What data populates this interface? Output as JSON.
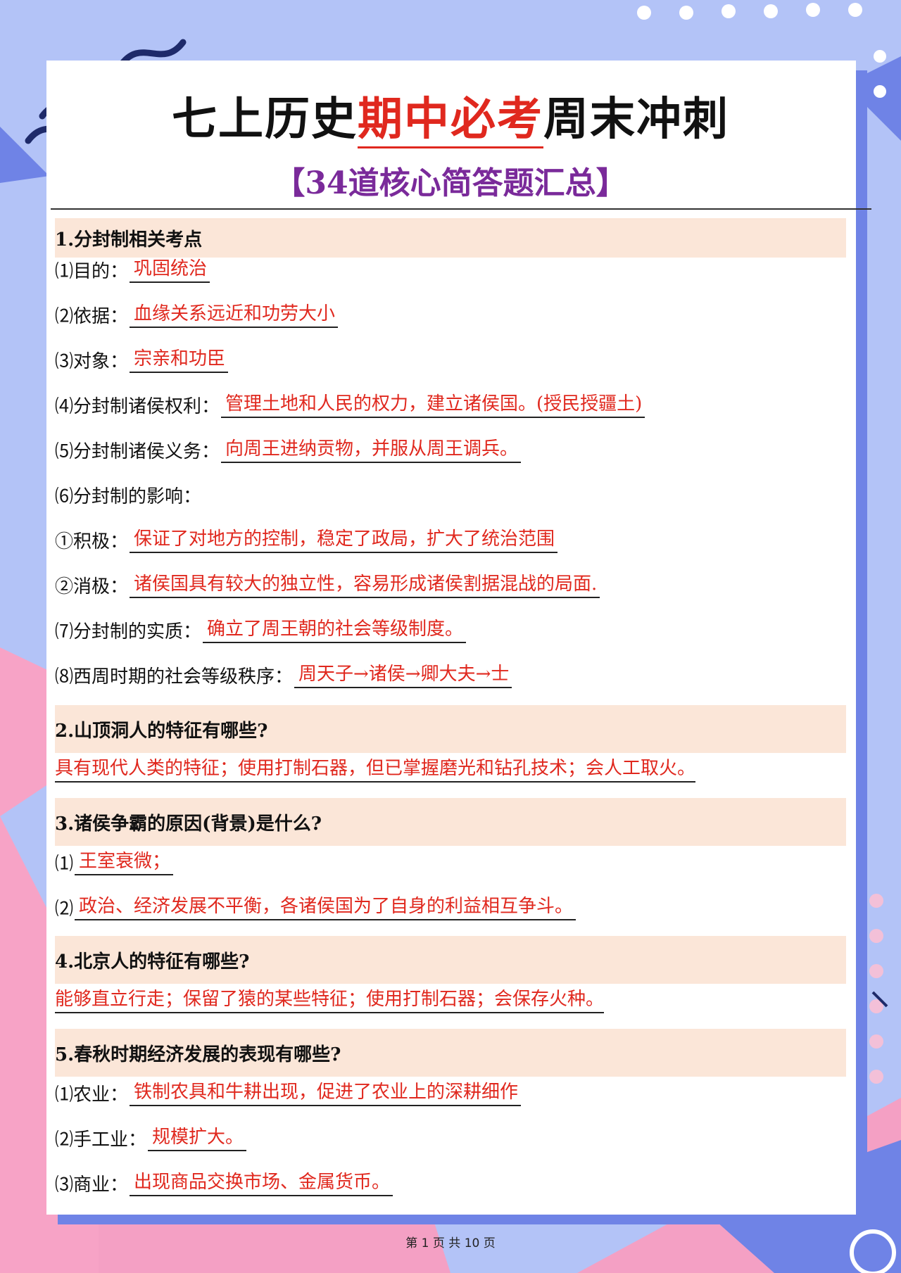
{
  "header": {
    "title_pre": "七上历史",
    "title_highlight": "期中必考",
    "title_post": "周末冲刺",
    "subtitle": "【34道核心简答题汇总】"
  },
  "sections": {
    "s1": {
      "heading": "1.分封制相关考点",
      "items": [
        {
          "label": "⑴目的：",
          "answer": "巩固统治"
        },
        {
          "label": "⑵依据：",
          "answer": "血缘关系远近和功劳大小"
        },
        {
          "label": "⑶对象：",
          "answer": "宗亲和功臣"
        },
        {
          "label": "⑷分封制诸侯权利：",
          "answer": "管理土地和人民的权力，建立诸侯国。(授民授疆土)"
        },
        {
          "label": "⑸分封制诸侯义务：",
          "answer": "向周王进纳贡物，并服从周王调兵。"
        },
        {
          "label": "⑹分封制的影响："
        },
        {
          "label": "①积极：",
          "answer": "保证了对地方的控制，稳定了政局，扩大了统治范围"
        },
        {
          "label": "②消极：",
          "answer": "诸侯国具有较大的独立性，容易形成诸侯割据混战的局面."
        },
        {
          "label": "⑺分封制的实质：",
          "answer": "确立了周王朝的社会等级制度。"
        },
        {
          "label": "⑻西周时期的社会等级秩序：",
          "answer": "周天子→诸侯→卿大夫→士"
        }
      ]
    },
    "s2": {
      "heading": "2.山顶洞人的特征有哪些?",
      "answer": "具有现代人类的特征；使用打制石器，但已掌握磨光和钻孔技术；会人工取火。"
    },
    "s3": {
      "heading": "3.诸侯争霸的原因(背景)是什么?",
      "items": [
        {
          "label": "⑴",
          "answer": "王室衰微；"
        },
        {
          "label": "⑵",
          "answer": "政治、经济发展不平衡，各诸侯国为了自身的利益相互争斗。"
        }
      ]
    },
    "s4": {
      "heading": "4.北京人的特征有哪些?",
      "answer": "能够直立行走；保留了猿的某些特征；使用打制石器；会保存火种。"
    },
    "s5": {
      "heading": "5.春秋时期经济发展的表现有哪些?",
      "items": [
        {
          "label": "⑴农业：",
          "answer": "铁制农具和牛耕出现，促进了农业上的深耕细作"
        },
        {
          "label": "⑵手工业：",
          "answer": "规模扩大。"
        },
        {
          "label": "⑶商业：",
          "answer": "出现商品交换市场、金属货币。"
        }
      ]
    }
  },
  "footer": {
    "page_text": "第 1 页 共 10 页"
  },
  "colors": {
    "answer": "#e0281e",
    "heading_bg": "#fbe6d8",
    "subtitle": "#7a2a9a",
    "background": "#b3c3f7"
  }
}
